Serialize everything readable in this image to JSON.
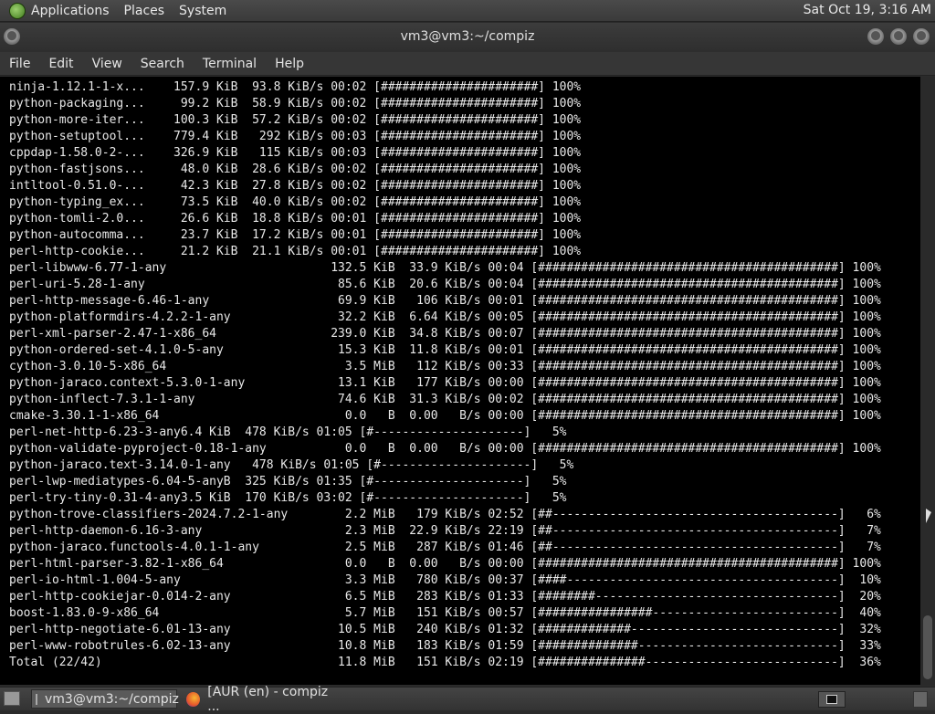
{
  "top_panel": {
    "menus": [
      "Applications",
      "Places",
      "System"
    ],
    "clock": "Sat Oct 19,  3:16 AM"
  },
  "window": {
    "title": "vm3@vm3:~/compiz"
  },
  "menubar": [
    "File",
    "Edit",
    "View",
    "Search",
    "Terminal",
    "Help"
  ],
  "terminal_lines": [
    "ninja-1.12.1-1-x...    157.9 KiB  93.8 KiB/s 00:02 [######################] 100%",
    "python-packaging...     99.2 KiB  58.9 KiB/s 00:02 [######################] 100%",
    "python-more-iter...    100.3 KiB  57.2 KiB/s 00:02 [######################] 100%",
    "python-setuptool...    779.4 KiB   292 KiB/s 00:03 [######################] 100%",
    "cppdap-1.58.0-2-...    326.9 KiB   115 KiB/s 00:03 [######################] 100%",
    "python-fastjsons...     48.0 KiB  28.6 KiB/s 00:02 [######################] 100%",
    "intltool-0.51.0-...     42.3 KiB  27.8 KiB/s 00:02 [######################] 100%",
    "python-typing_ex...     73.5 KiB  40.0 KiB/s 00:02 [######################] 100%",
    "python-tomli-2.0...     26.6 KiB  18.8 KiB/s 00:01 [######################] 100%",
    "python-autocomma...     23.7 KiB  17.2 KiB/s 00:01 [######################] 100%",
    "perl-http-cookie...     21.2 KiB  21.1 KiB/s 00:01 [######################] 100%",
    "perl-libwww-6.77-1-any                       132.5 KiB  33.9 KiB/s 00:04 [##########################################] 100%",
    "perl-uri-5.28-1-any                           85.6 KiB  20.6 KiB/s 00:04 [##########################################] 100%",
    "perl-http-message-6.46-1-any                  69.9 KiB   106 KiB/s 00:01 [##########################################] 100%",
    "python-platformdirs-4.2.2-1-any               32.2 KiB  6.64 KiB/s 00:05 [##########################################] 100%",
    "perl-xml-parser-2.47-1-x86_64                239.0 KiB  34.8 KiB/s 00:07 [##########################################] 100%",
    "python-ordered-set-4.1.0-5-any                15.3 KiB  11.8 KiB/s 00:01 [##########################################] 100%",
    "cython-3.0.10-5-x86_64                         3.5 MiB   112 KiB/s 00:33 [##########################################] 100%",
    "python-jaraco.context-5.3.0-1-any             13.1 KiB   177 KiB/s 00:00 [##########################################] 100%",
    "python-inflect-7.3.1-1-any                    74.6 KiB  31.3 KiB/s 00:02 [##########################################] 100%",
    "cmake-3.30.1-1-x86_64                          0.0   B  0.00   B/s 00:00 [##########################################] 100%",
    "perl-net-http-6.23-3-any6.4 KiB  478 KiB/s 01:05 [#---------------------]   5%",
    "python-validate-pyproject-0.18-1-any           0.0   B  0.00   B/s 00:00 [##########################################] 100%",
    "python-jaraco.text-3.14.0-1-any   478 KiB/s 01:05 [#---------------------]   5%",
    "perl-lwp-mediatypes-6.04-5-anyB  325 KiB/s 01:35 [#---------------------]   5%",
    "perl-try-tiny-0.31-4-any3.5 KiB  170 KiB/s 03:02 [#---------------------]   5%",
    "python-trove-classifiers-2024.7.2-1-any        2.2 MiB   179 KiB/s 02:52 [##----------------------------------------]   6%",
    "perl-http-daemon-6.16-3-any                    2.3 MiB  22.9 KiB/s 22:19 [##----------------------------------------]   7%",
    "python-jaraco.functools-4.0.1-1-any            2.5 MiB   287 KiB/s 01:46 [##----------------------------------------]   7%",
    "perl-html-parser-3.82-1-x86_64                 0.0   B  0.00   B/s 00:00 [##########################################] 100%",
    "perl-io-html-1.004-5-any                       3.3 MiB   780 KiB/s 00:37 [####--------------------------------------]  10%",
    "perl-http-cookiejar-0.014-2-any                6.5 MiB   283 KiB/s 01:33 [########----------------------------------]  20%",
    "boost-1.83.0-9-x86_64                          5.7 MiB   151 KiB/s 00:57 [################--------------------------]  40%",
    "perl-http-negotiate-6.01-13-any               10.5 MiB   240 KiB/s 01:32 [#############-----------------------------]  32%",
    "perl-www-robotrules-6.02-13-any               10.8 MiB   183 KiB/s 01:59 [##############----------------------------]  33%",
    "Total (22/42)                                 11.8 MiB   151 KiB/s 02:19 [###############---------------------------]  36%"
  ],
  "taskbar": {
    "tasks": [
      "vm3@vm3:~/compiz",
      "[AUR (en) - compiz ..."
    ]
  }
}
